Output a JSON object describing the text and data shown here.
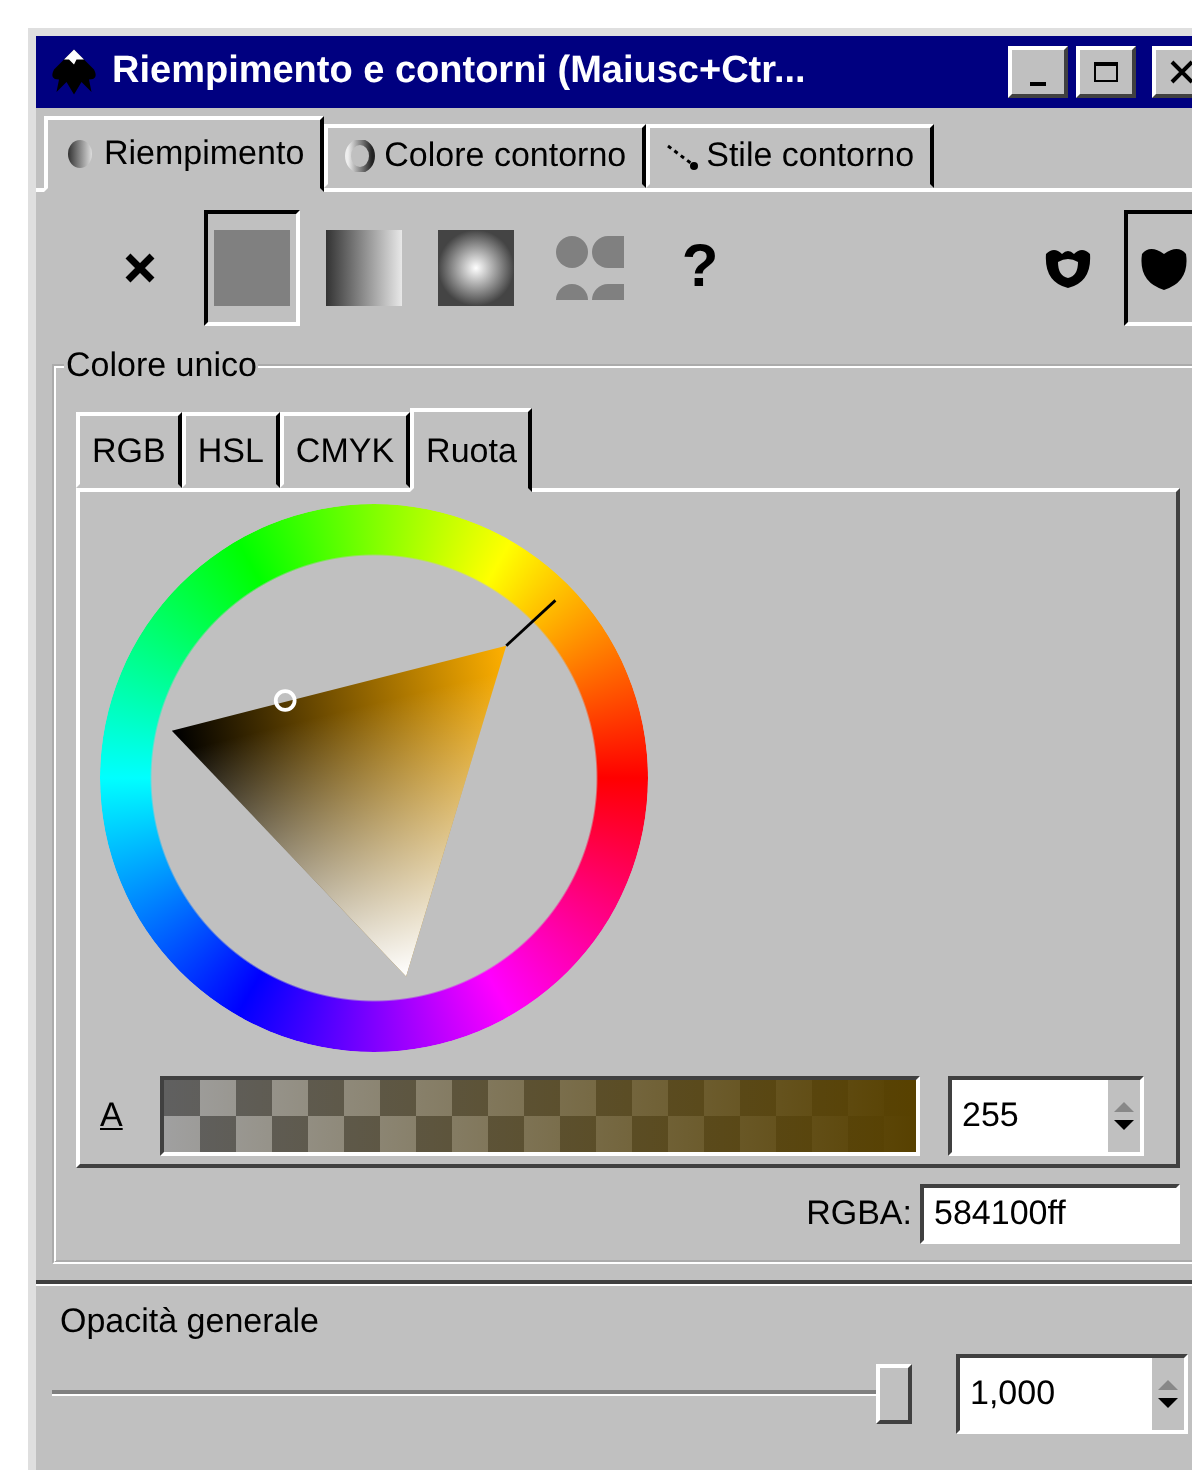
{
  "window": {
    "title": "Riempimento e contorni (Maiusc+Ctr..."
  },
  "tabs": [
    {
      "label": "Riempimento",
      "kind": "fill",
      "selected": true
    },
    {
      "label": "Colore contorno",
      "kind": "stroke",
      "selected": false
    },
    {
      "label": "Stile contorno",
      "kind": "style",
      "selected": false
    }
  ],
  "fill_modes": [
    {
      "kind": "none",
      "selected": false
    },
    {
      "kind": "flat",
      "selected": true
    },
    {
      "kind": "linear",
      "selected": false
    },
    {
      "kind": "radial",
      "selected": false
    },
    {
      "kind": "pattern",
      "selected": false
    },
    {
      "kind": "unset",
      "glyph": "?",
      "selected": false
    }
  ],
  "fill_rules": [
    {
      "kind": "evenodd",
      "selected": false
    },
    {
      "kind": "nonzero",
      "selected": true
    }
  ],
  "color_frame": {
    "label": "Colore unico",
    "tabs": [
      {
        "label": "RGB",
        "selected": false
      },
      {
        "label": "HSL",
        "selected": false
      },
      {
        "label": "CMYK",
        "selected": false
      },
      {
        "label": "Ruota",
        "selected": true
      }
    ],
    "alpha": {
      "label": "A",
      "level": 1,
      "value": "255"
    },
    "rgba": {
      "label": "RGBA:",
      "value": "584100ff"
    }
  },
  "opacity": {
    "label": "Opacità generale",
    "level": 1,
    "value": "1,000"
  }
}
